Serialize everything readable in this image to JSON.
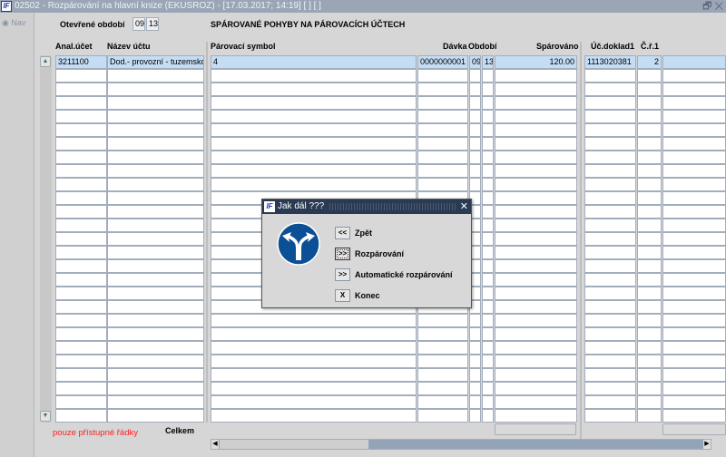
{
  "window": {
    "logo": "IF",
    "title": "02502 - Rozpárování na hlavní knize (EKUSROZ) - [17.03.2017; 14:19]  [ ]  [ ]",
    "restore": "🗗",
    "close": "✕"
  },
  "nav": {
    "label": "Nav"
  },
  "header": {
    "period_label": "Otevřené období",
    "period_month": "09",
    "period_year": "13",
    "section_title": "SPÁROVANÉ POHYBY NA PÁROVACÍCH ÚČTECH"
  },
  "columns": {
    "anal": "Anal.účet",
    "nazev": "Název účtu",
    "symbol": "Párovací symbol",
    "davka": "Dávka",
    "obdobi": "Období",
    "sparovano": "Spárováno",
    "doklad": "Úč.doklad1",
    "cr": "Č.ř.1"
  },
  "rows": [
    {
      "anal": "3211100",
      "nazev": "Dod.- provozní - tuzemsko,",
      "symbol": "4",
      "davka": "0000000001",
      "m": "09",
      "y": "13",
      "sparovano": "120.00",
      "doklad": "1113020381",
      "cr": "2",
      "extra": ""
    }
  ],
  "empty_row_count": 26,
  "footer": {
    "note": "pouze přístupné řádky",
    "total_label": "Celkem",
    "note_color": "#ff2020"
  },
  "dialog": {
    "logo": "IF",
    "title": "Jak dál ???",
    "close": "✕",
    "buttons": [
      {
        "key": "<<",
        "label": "Zpět"
      },
      {
        "key": ">>",
        "label": "Rozpárování"
      },
      {
        "key": ">>",
        "label": "Automatické rozpárování"
      },
      {
        "key": "X",
        "label": "Konec"
      }
    ]
  }
}
